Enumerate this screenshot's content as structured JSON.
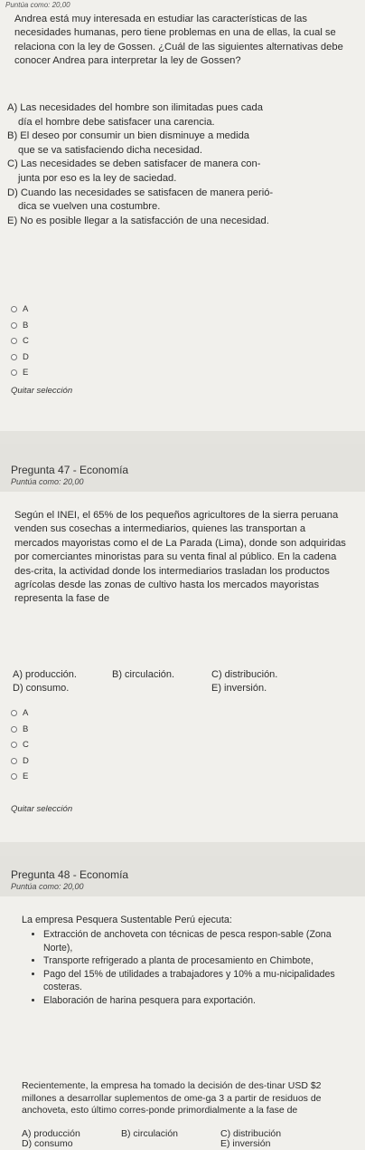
{
  "q46": {
    "score_label": "Puntúa como: 20,00",
    "statement": "Andrea está muy interesada en estudiar las características de las necesidades humanas, pero tiene problemas en una de ellas, la cual se relaciona con la ley de Gossen. ¿Cuál de las siguientes alternativas debe conocer Andrea para interpretar la ley de Gossen?",
    "options": [
      {
        "line1": "A) Las necesidades del hombre son ilimitadas pues cada",
        "line2": "día el hombre debe satisfacer una carencia."
      },
      {
        "line1": "B) El deseo por consumir un bien disminuye a medida",
        "line2": "que se va satisfaciendo dicha necesidad."
      },
      {
        "line1": "C) Las necesidades se deben satisfacer de manera con-",
        "line2": "junta por eso es la ley de saciedad."
      },
      {
        "line1": "D) Cuando las necesidades se satisfacen de manera perió-",
        "line2": "dica se vuelven una costumbre."
      },
      {
        "line1": "E) No es posible llegar a la satisfacción de una necesidad.",
        "line2": ""
      }
    ],
    "radios": [
      "A",
      "B",
      "C",
      "D",
      "E"
    ],
    "clear": "Quitar selección"
  },
  "q47": {
    "title": "Pregunta 47 - Economía",
    "score_label": "Puntúa como: 20,00",
    "statement": "Según el INEI, el 65% de los pequeños agricultores de la sierra peruana venden sus cosechas a intermediarios, quienes las transportan a mercados mayoristas como el de La Parada (Lima), donde son adquiridas por comerciantes minoristas para su venta final al público. En la cadena des-crita, la actividad donde los intermediarios trasladan los productos agrícolas desde las zonas de cultivo hasta los mercados mayoristas representa la fase de",
    "choices": [
      "A) producción.",
      "B) circulación.",
      "C) distribución.",
      "D) consumo.",
      "",
      "E) inversión."
    ],
    "radios": [
      "A",
      "B",
      "C",
      "D",
      "E"
    ],
    "clear": "Quitar selección"
  },
  "q48": {
    "title": "Pregunta 48 - Economía",
    "score_label": "Puntúa como: 20,00",
    "intro": "La empresa Pesquera Sustentable Perú ejecuta:",
    "bullets": [
      "Extracción de anchoveta con técnicas de pesca respon-sable (Zona Norte),",
      "Transporte refrigerado a planta de procesamiento en Chimbote,",
      "Pago del 15% de utilidades a trabajadores y 10% a mu-nicipalidades costeras.",
      "Elaboración de harina pesquera para exportación."
    ],
    "statement": "Recientemente, la empresa ha tomado la decisión de des-tinar USD $2 millones a desarrollar suplementos de ome-ga 3 a partir de residuos de anchoveta, esto último corres-ponde primordialmente a la fase de",
    "choices": [
      "A) producción",
      "B) circulación",
      "C) distribución",
      "D) consumo",
      "",
      "E) inversión"
    ]
  }
}
